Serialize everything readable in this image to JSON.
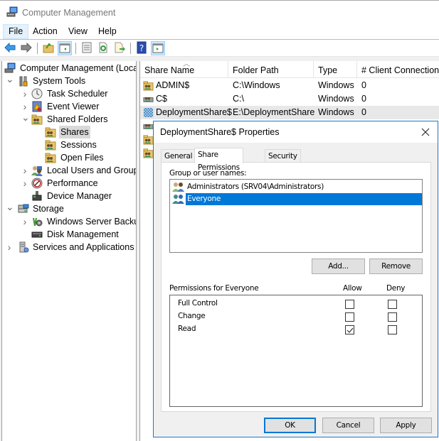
{
  "window": {
    "title": "Computer Management",
    "icon": "computer-management-icon"
  },
  "menu": {
    "items": [
      {
        "label": "File",
        "active": true
      },
      {
        "label": "Action",
        "active": false
      },
      {
        "label": "View",
        "active": false
      },
      {
        "label": "Help",
        "active": false
      }
    ]
  },
  "toolbar": {
    "buttons": [
      {
        "icon": "back-arrow-icon",
        "pressed": false
      },
      {
        "icon": "forward-arrow-icon",
        "pressed": false
      },
      {
        "icon": "up-folder-icon",
        "pressed": false
      },
      {
        "icon": "show-hide-console-tree-icon",
        "pressed": true
      },
      {
        "icon": "properties-icon",
        "pressed": false
      },
      {
        "icon": "refresh-icon",
        "pressed": false
      },
      {
        "icon": "export-list-icon",
        "pressed": false
      },
      {
        "icon": "help-icon",
        "pressed": false
      },
      {
        "icon": "show-hide-action-pane-icon",
        "pressed": true
      }
    ]
  },
  "tree": {
    "items": [
      {
        "label": "Computer Management (Local",
        "level": 0,
        "expander": "none",
        "icon": "computer-management-icon",
        "selected": false
      },
      {
        "label": "System Tools",
        "level": 1,
        "expander": "expanded",
        "icon": "tools-icon",
        "selected": false
      },
      {
        "label": "Task Scheduler",
        "level": 2,
        "expander": "collapsed",
        "icon": "clock-icon",
        "selected": false
      },
      {
        "label": "Event Viewer",
        "level": 2,
        "expander": "collapsed",
        "icon": "event-viewer-icon",
        "selected": false
      },
      {
        "label": "Shared Folders",
        "level": 2,
        "expander": "expanded",
        "icon": "shared-folder-icon",
        "selected": false
      },
      {
        "label": "Shares",
        "level": 3,
        "expander": "none",
        "icon": "shared-folder-icon",
        "selected": true
      },
      {
        "label": "Sessions",
        "level": 3,
        "expander": "none",
        "icon": "shared-folder-icon",
        "selected": false
      },
      {
        "label": "Open Files",
        "level": 3,
        "expander": "none",
        "icon": "shared-folder-icon",
        "selected": false
      },
      {
        "label": "Local Users and Groups",
        "level": 2,
        "expander": "collapsed",
        "icon": "users-icon",
        "selected": false
      },
      {
        "label": "Performance",
        "level": 2,
        "expander": "collapsed",
        "icon": "performance-icon",
        "selected": false
      },
      {
        "label": "Device Manager",
        "level": 2,
        "expander": "none",
        "icon": "device-manager-icon",
        "selected": false
      },
      {
        "label": "Storage",
        "level": 1,
        "expander": "expanded",
        "icon": "storage-icon",
        "selected": false
      },
      {
        "label": "Windows Server Backup",
        "level": 2,
        "expander": "collapsed",
        "icon": "backup-icon",
        "selected": false
      },
      {
        "label": "Disk Management",
        "level": 2,
        "expander": "none",
        "icon": "disk-icon",
        "selected": false
      },
      {
        "label": "Services and Applications",
        "level": 1,
        "expander": "collapsed",
        "icon": "services-icon",
        "selected": false
      }
    ]
  },
  "shares": {
    "columns": [
      "Share Name",
      "Folder Path",
      "Type",
      "# Client Connections"
    ],
    "rows": [
      {
        "name": "ADMIN$",
        "path": "C:\\Windows",
        "type": "Windows",
        "connections": "0",
        "icon": "shared-folder-icon",
        "hover": false
      },
      {
        "name": "C$",
        "path": "C:\\",
        "type": "Windows",
        "connections": "0",
        "icon": "shared-drive-icon",
        "hover": false
      },
      {
        "name": "DeploymentShare$",
        "path": "E:\\DeploymentShare",
        "type": "Windows",
        "connections": "0",
        "icon": "shared-folder-selected-icon",
        "hover": true
      },
      {
        "name": "",
        "path": "",
        "type": "",
        "connections": "",
        "icon": "shared-drive-icon",
        "hover": false
      },
      {
        "name": "",
        "path": "",
        "type": "",
        "connections": "",
        "icon": "shared-folder-icon",
        "hover": false
      },
      {
        "name": "",
        "path": "",
        "type": "",
        "connections": "",
        "icon": "shared-folder-icon",
        "hover": false
      }
    ]
  },
  "dialog": {
    "title": "DeploymentShare$ Properties",
    "tabs": [
      {
        "label": "General",
        "active": false
      },
      {
        "label": "Share Permissions",
        "active": true
      },
      {
        "label": "Security",
        "active": false
      }
    ],
    "group_label": "Group or user names:",
    "users": [
      {
        "label": "Administrators (SRV04\\Administrators)",
        "selected": false
      },
      {
        "label": "Everyone",
        "selected": true
      }
    ],
    "add_label": "Add...",
    "remove_label": "Remove",
    "perms_label": "Permissions for Everyone",
    "allow_label": "Allow",
    "deny_label": "Deny",
    "permissions": [
      {
        "name": "Full Control",
        "allow": false,
        "deny": false
      },
      {
        "name": "Change",
        "allow": false,
        "deny": false
      },
      {
        "name": "Read",
        "allow": true,
        "deny": false
      }
    ],
    "ok_label": "OK",
    "cancel_label": "Cancel",
    "apply_label": "Apply"
  },
  "colors": {
    "accent": "#0078d7",
    "dialog_border": "#1979ca",
    "selected_tree": "#d9d9d9"
  }
}
